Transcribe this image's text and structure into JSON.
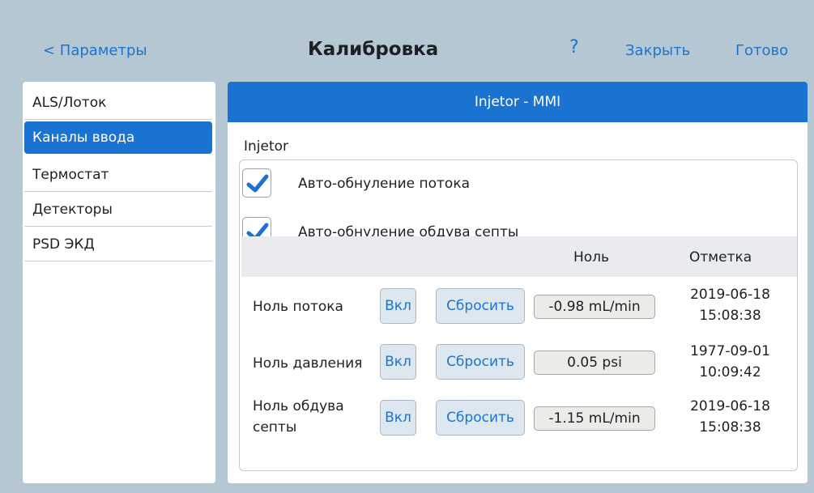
{
  "header": {
    "back_label": "< Параметры",
    "title": "Калибровка",
    "help_label": "?",
    "close_label": "Закрыть",
    "done_label": "Готово"
  },
  "sidebar": {
    "items": [
      {
        "label": "ALS/Лоток"
      },
      {
        "label": "Каналы ввода"
      },
      {
        "label": "Термостат"
      },
      {
        "label": "Детекторы"
      },
      {
        "label": "PSD ЭКД"
      }
    ],
    "active_index": 1
  },
  "panel": {
    "title": "Injetor - MMI",
    "section_label": "Injetor",
    "checkboxes": [
      {
        "label": "Авто-обнуление потока",
        "checked": true
      },
      {
        "label": "Авто-обнуление обдува септы",
        "checked": true
      }
    ],
    "table": {
      "columns": [
        "Ноль",
        "Отметка"
      ],
      "rows": [
        {
          "label": "Ноль потока",
          "on_label": "Вкл",
          "reset_label": "Сбросить",
          "value": "-0.98 mL/min",
          "date": "2019-06-18",
          "time": "15:08:38"
        },
        {
          "label": "Ноль давления",
          "on_label": "Вкл",
          "reset_label": "Сбросить",
          "value": "0.05 psi",
          "date": "1977-09-01",
          "time": "10:09:42"
        },
        {
          "label_line1": "Ноль обдува",
          "label_line2": "септы",
          "on_label": "Вкл",
          "reset_label": "Сбросить",
          "value": "-1.15 mL/min",
          "date": "2019-06-18",
          "time": "15:08:38"
        }
      ]
    }
  },
  "colors": {
    "accent": "#1a73d0",
    "background": "#b6c7d4",
    "check": "#1a73d0"
  }
}
